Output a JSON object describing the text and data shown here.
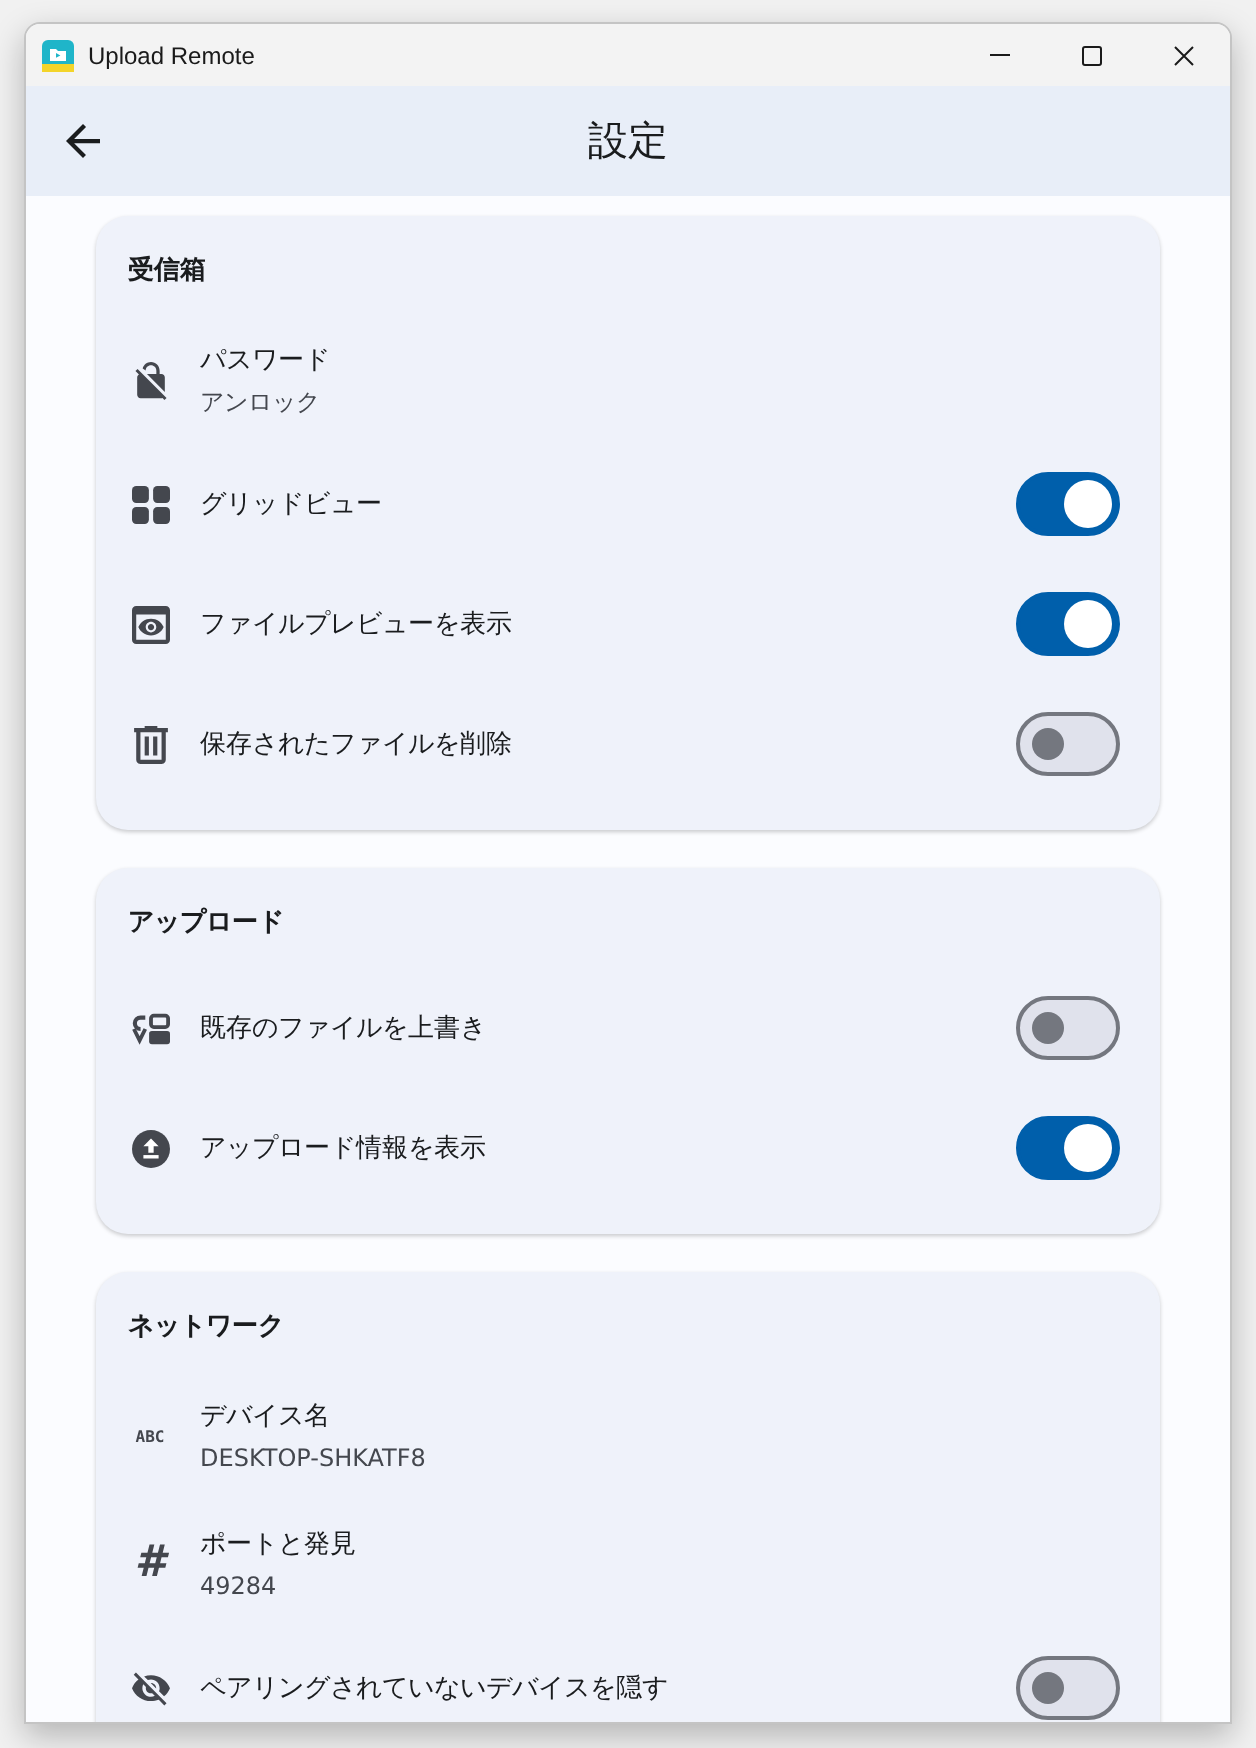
{
  "window": {
    "title": "Upload Remote"
  },
  "app_bar": {
    "title": "設定"
  },
  "sections": [
    {
      "title": "受信箱",
      "rows": [
        {
          "kind": "detail",
          "label": "パスワード",
          "value": "アンロック"
        },
        {
          "kind": "switch",
          "label": "グリッドビュー",
          "on": true
        },
        {
          "kind": "switch",
          "label": "ファイルプレビューを表示",
          "on": true
        },
        {
          "kind": "switch",
          "label": "保存されたファイルを削除",
          "on": false
        }
      ]
    },
    {
      "title": "アップロード",
      "rows": [
        {
          "kind": "switch",
          "label": "既存のファイルを上書き",
          "on": false
        },
        {
          "kind": "switch",
          "label": "アップロード情報を表示",
          "on": true
        }
      ]
    },
    {
      "title": "ネットワーク",
      "rows": [
        {
          "kind": "detail",
          "glyph": "ABC",
          "label": "デバイス名",
          "value": "DESKTOP-SHKATF8"
        },
        {
          "kind": "detail",
          "glyph": "#",
          "label": "ポートと発見",
          "value": "49284"
        },
        {
          "kind": "switch",
          "label": "ペアリングされていないデバイスを隠す",
          "on": false
        }
      ]
    }
  ]
}
